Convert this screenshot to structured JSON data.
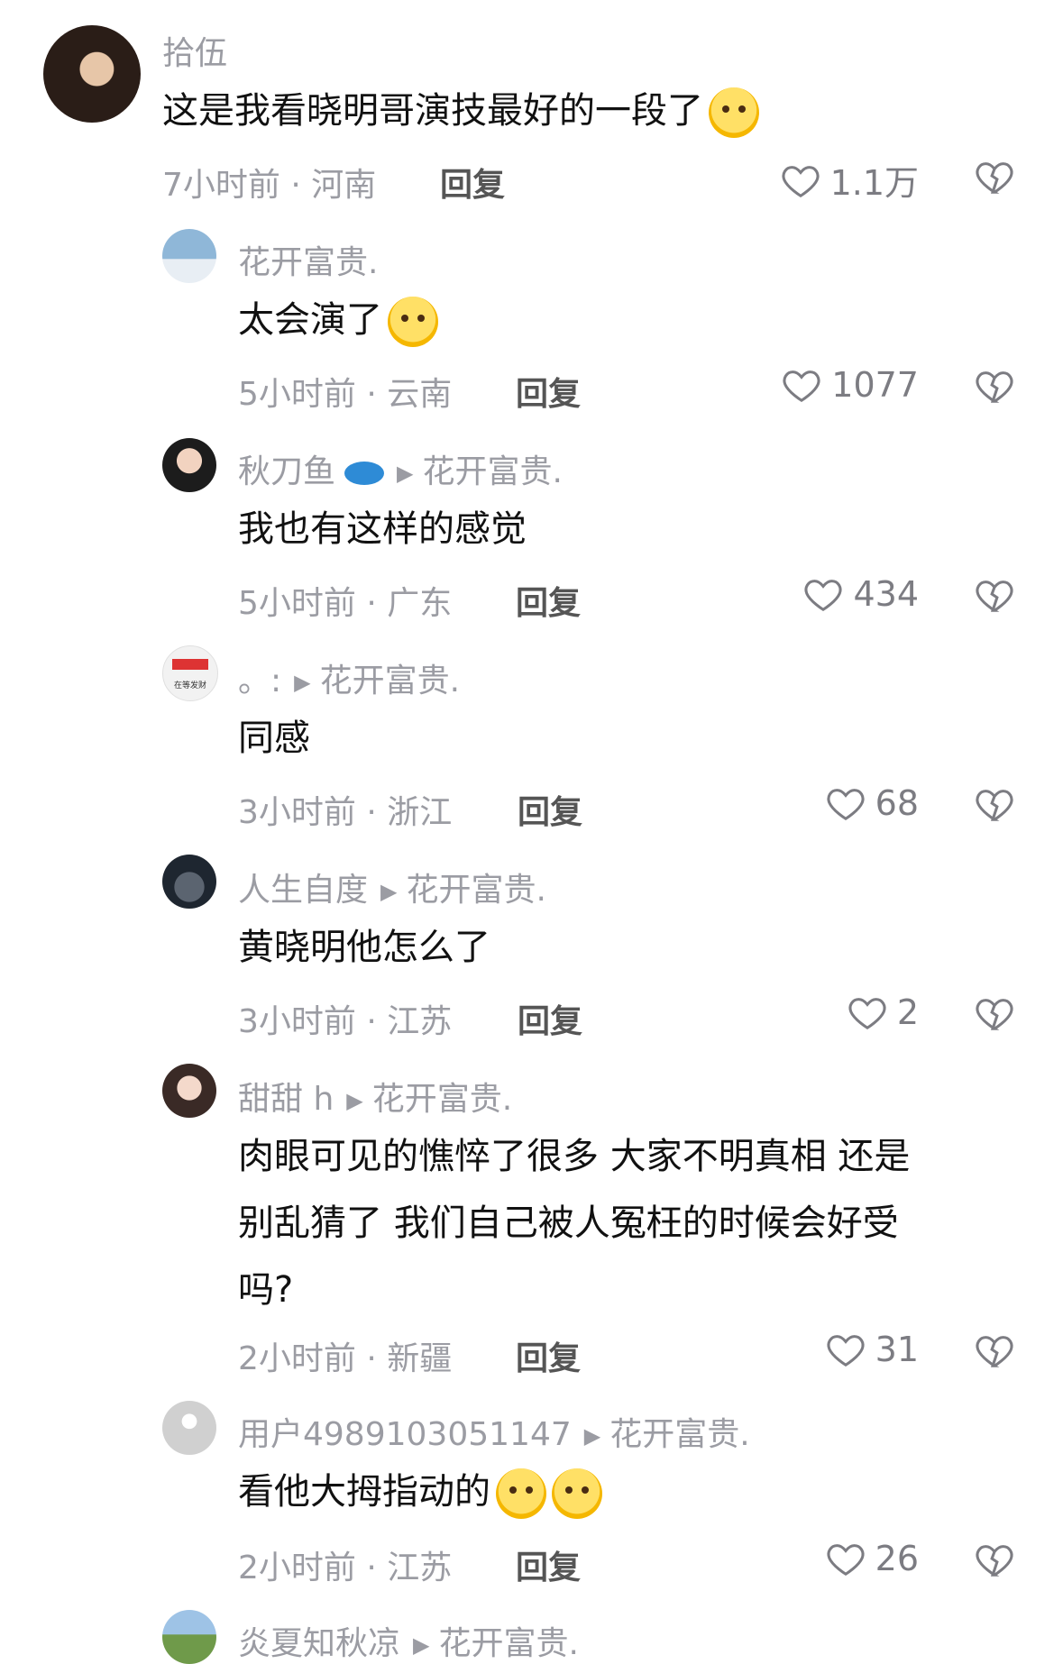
{
  "comments": [
    {
      "name": "拾伍",
      "text": "这是我看晓明哥演技最好的一段了",
      "meta": "7小时前 · 河南",
      "reply": "回复",
      "likes": "1.1万"
    },
    {
      "name": "花开富贵.",
      "text": "太会演了",
      "meta": "5小时前 · 云南",
      "reply": "回复",
      "likes": "1077"
    },
    {
      "name": "秋刀鱼",
      "reply_to": "花开富贵.",
      "text": "我也有这样的感觉",
      "meta": "5小时前 · 广东",
      "reply": "回复",
      "likes": "434"
    },
    {
      "name": "。:",
      "reply_to": "花开富贵.",
      "text": "同感",
      "meta": "3小时前 · 浙江",
      "reply": "回复",
      "likes": "68",
      "avatar_label": "在等发财"
    },
    {
      "name": "人生自度",
      "reply_to": "花开富贵.",
      "text": "黄晓明他怎么了",
      "meta": "3小时前 · 江苏",
      "reply": "回复",
      "likes": "2"
    },
    {
      "name": "甜甜 h",
      "reply_to": "花开富贵.",
      "text_lines": [
        "肉眼可见的憔悴了很多  大家不明真相  还是",
        "别乱猜了   我们自己被人冤枉的时候会好受",
        "吗?"
      ],
      "meta": "2小时前 · 新疆",
      "reply": "回复",
      "likes": "31"
    },
    {
      "name": "用户4989103051147",
      "reply_to": "花开富贵.",
      "text": "看他大拇指动的",
      "meta": "2小时前 · 江苏",
      "reply": "回复",
      "likes": "26"
    },
    {
      "name": "炎夏知秋凉",
      "reply_to": "花开富贵."
    }
  ],
  "icons": {
    "like": "heart-outline-icon",
    "dislike": "broken-heart-icon",
    "reply_arrow": "triangle-right-icon"
  },
  "colors": {
    "secondary_text": "#9b9ca3",
    "primary_text": "#111111"
  }
}
